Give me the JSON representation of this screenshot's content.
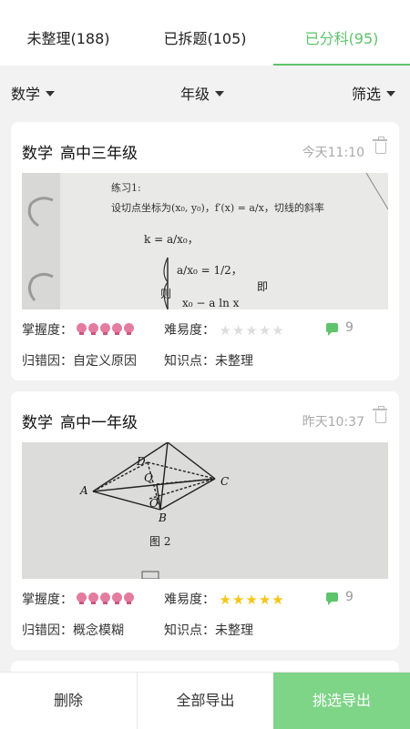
{
  "tabs": [
    {
      "label": "未整理(188)"
    },
    {
      "label": "已拆题(105)"
    },
    {
      "label": "已分科(95)"
    }
  ],
  "filters": {
    "subject": "数学",
    "grade": "年级",
    "filter": "筛选"
  },
  "cards": [
    {
      "subject": "数学",
      "grade": "高中三年级",
      "time": "今天11:10",
      "mastery_label": "掌握度：",
      "difficulty_label": "难易度：",
      "difficulty_stars": "★★★★★",
      "difficulty_value": 0,
      "comments": "9",
      "cause_label": "归错因：",
      "cause_value": "自定义原因",
      "knowledge_label": "知识点：",
      "knowledge_value": "未整理",
      "photo_text": {
        "line1": "练习1:",
        "line2": "设切点坐标为(x₀, y₀)，f′(x) = a/x，切线的斜率",
        "line3": "k = a/x₀，",
        "line4": "a/x₀ = 1/2，",
        "line5": "则",
        "line6": "即",
        "line7": "x₀ − a ln x"
      }
    },
    {
      "subject": "数学",
      "grade": "高中一年级",
      "time": "昨天10:37",
      "mastery_label": "掌握度：",
      "difficulty_label": "难易度：",
      "difficulty_stars": "★★★★★",
      "difficulty_value": 5,
      "comments": "9",
      "cause_label": "归错因：",
      "cause_value": "概念模糊",
      "knowledge_label": "知识点：",
      "knowledge_value": "未整理",
      "photo_text": {
        "a": "A",
        "b": "B",
        "c": "C",
        "d": "D",
        "q": "Q",
        "o": "O",
        "caption": "图 2"
      }
    }
  ],
  "bottom": {
    "delete": "删除",
    "export_all": "全部导出",
    "export_selected": "挑选导出"
  },
  "colors": {
    "accent": "#5ec46a",
    "star_on": "#f5c518",
    "star_off": "#dddddd",
    "bulb": "#e47ca0"
  }
}
